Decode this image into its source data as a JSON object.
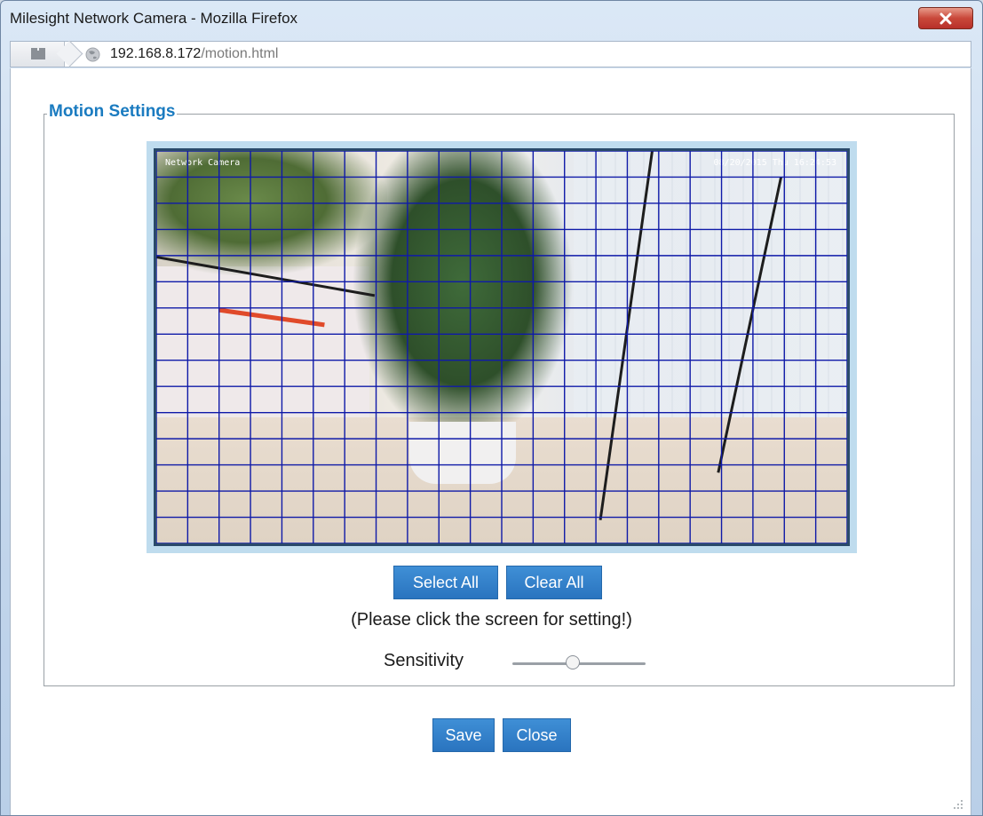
{
  "window": {
    "title": "Milesight Network Camera - Mozilla Firefox"
  },
  "address": {
    "host": "192.168.8.172",
    "path": "/motion.html"
  },
  "motion": {
    "legend": "Motion Settings",
    "osd_left": "Network Camera",
    "osd_right": "08/20/2015 Thu 16:24:53",
    "grid": {
      "columns": 22,
      "rows": 15,
      "line_color": "#0f1aa8"
    },
    "select_all_label": "Select All",
    "clear_all_label": "Clear All",
    "hint": "(Please click the screen for setting!)",
    "sensitivity_label": "Sensitivity",
    "sensitivity_value": 0.45
  },
  "footer": {
    "save_label": "Save",
    "close_label": "Close"
  },
  "icons": {
    "close": "close-x-icon",
    "page": "page-icon",
    "globe": "globe-icon",
    "grip": "resize-grip-icon"
  },
  "colors": {
    "accent": "#1a7bc0",
    "button": "#2a74bf",
    "close_button": "#c9483a"
  }
}
